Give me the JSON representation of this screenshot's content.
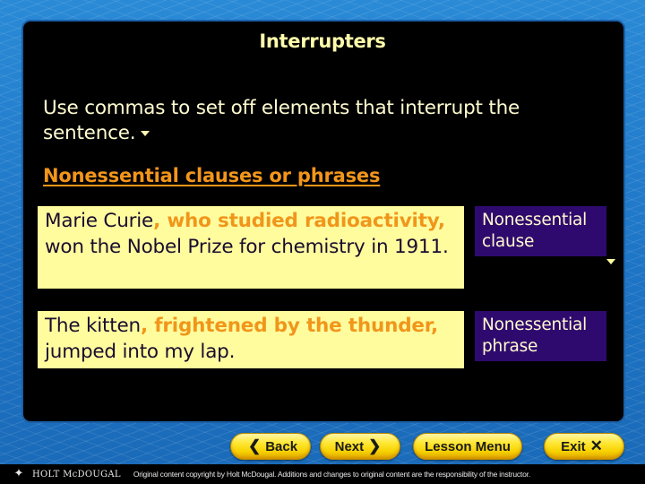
{
  "slide": {
    "title": "Interrupters",
    "intro": "Use commas to set off elements that interrupt the sentence.",
    "subheading": "Nonessential clauses or phrases"
  },
  "examples": [
    {
      "before": "Marie Curie",
      "highlight": ", who studied radioactivity,",
      "after": " won the Nobel Prize for chemistry in 1911.",
      "label": "Nonessential clause"
    },
    {
      "before": "The kitten",
      "highlight": ", frightened by the thunder,",
      "after": " jumped into my lap.",
      "label": "Nonessential phrase"
    }
  ],
  "nav": {
    "back": "Back",
    "next": "Next",
    "lesson_menu": "Lesson Menu",
    "exit": "Exit",
    "back_icon": "chevron-left-icon",
    "next_icon": "chevron-right-icon",
    "exit_icon": "close-icon"
  },
  "footer": {
    "brand": "HOLT McDOUGAL",
    "copyright": "Original content copyright by Holt McDougal. Additions and changes to original content are the responsibility of the instructor.",
    "logo_icon": "holt-logo-icon"
  },
  "colors": {
    "title": "#fffcaa",
    "subheading": "#f2961a",
    "highlight": "#f0961a",
    "example_bg": "#fffc9e",
    "label_bg": "#2e0a6e",
    "button": "#ffe838"
  }
}
